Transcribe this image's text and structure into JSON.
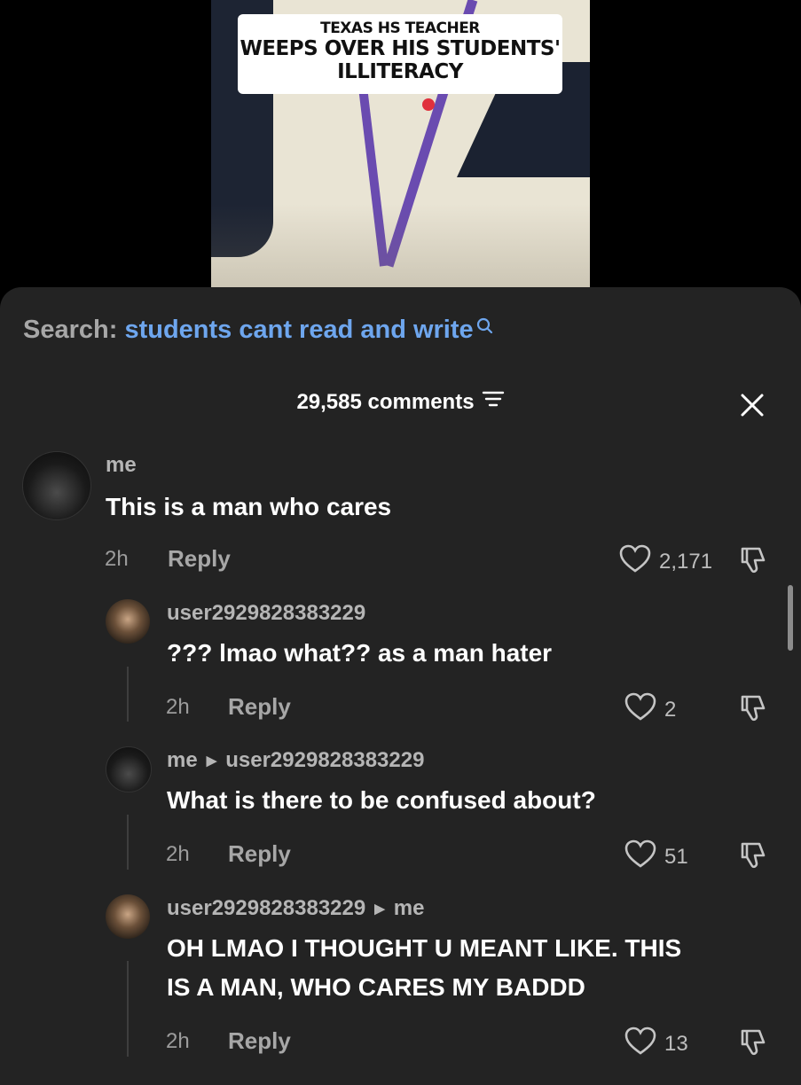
{
  "video": {
    "caption_line1": "TEXAS HS TEACHER",
    "caption_line2": "WEEPS OVER HIS STUDENTS'",
    "caption_line3": "ILLITERACY"
  },
  "search": {
    "label": "Search:",
    "query": "students cant read and write",
    "icon": "search-icon"
  },
  "comments_header": {
    "count_label": "29,585 comments",
    "sort_icon": "sort-icon",
    "close_icon": "close-icon"
  },
  "colors": {
    "sheet_bg": "#232323",
    "link_blue": "#6ea6ee",
    "muted_text": "#a7a7a7"
  },
  "comments": [
    {
      "user": "me",
      "text": "This is a man who cares",
      "time": "2h",
      "reply_label": "Reply",
      "likes": "2,171"
    },
    {
      "user": "user2929828383229",
      "text": "??? lmao what?? as a man hater",
      "time": "2h",
      "reply_label": "Reply",
      "likes": "2"
    },
    {
      "user": "me",
      "reply_to": "user2929828383229",
      "text": "What is there to be confused about?",
      "time": "2h",
      "reply_label": "Reply",
      "likes": "51"
    },
    {
      "user": "user2929828383229",
      "reply_to": "me",
      "text_line1": "OH LMAO I THOUGHT U MEANT LIKE. THIS",
      "text_line2": "IS A MAN, WHO CARES MY BADDD",
      "time": "2h",
      "reply_label": "Reply",
      "likes": "13"
    }
  ]
}
